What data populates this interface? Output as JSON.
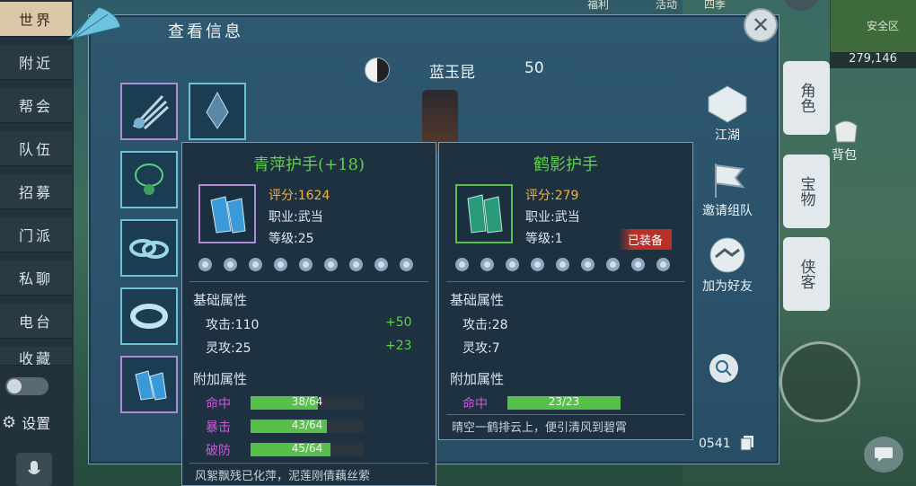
{
  "sidebar": {
    "tabs": [
      "世界",
      "附近",
      "帮会",
      "队伍",
      "招募",
      "门派",
      "私聊",
      "电台",
      "收藏"
    ],
    "active_index": 0,
    "settings_label": "设置"
  },
  "panel": {
    "title": "查看信息",
    "player": {
      "name": "蓝玉昆",
      "level": "50"
    },
    "actions": [
      "江湖",
      "邀请组队",
      "加为好友"
    ],
    "id_fragment": "0541"
  },
  "minimap": {
    "coords": "279,146",
    "zone": "安全区"
  },
  "right_tabs": [
    "角色",
    "宝物",
    "侠客"
  ],
  "map_labels": {
    "bag": "背包"
  },
  "top_hud": [
    "福利",
    "活动",
    "四季"
  ],
  "compare": {
    "left": {
      "name": "青萍护手(+18)",
      "score_label": "评分:1624",
      "class_label": "职业:武当",
      "level_label": "等级:25",
      "base_title": "基础属性",
      "base_stats": [
        {
          "label": "攻击:110",
          "bonus": "+50"
        },
        {
          "label": "灵攻:25",
          "bonus": "+23"
        }
      ],
      "extra_title": "附加属性",
      "extra_stats": [
        {
          "label": "命中",
          "text": "38/64",
          "value": 38,
          "max": 64,
          "color": "#c85ad8"
        },
        {
          "label": "暴击",
          "text": "43/64",
          "value": 43,
          "max": 64,
          "color": "#c85ad8"
        },
        {
          "label": "破防",
          "text": "45/64",
          "value": 45,
          "max": 64,
          "color": "#c85ad8"
        }
      ],
      "flavor": "风絮飘残已化萍，泥莲刚倩藕丝萦"
    },
    "right": {
      "name": "鹤影护手",
      "score_label": "评分:279",
      "class_label": "职业:武当",
      "level_label": "等级:1",
      "equipped_badge": "已装备",
      "base_title": "基础属性",
      "base_stats": [
        {
          "label": "攻击:28"
        },
        {
          "label": "灵攻:7"
        }
      ],
      "extra_title": "附加属性",
      "extra_stats": [
        {
          "label": "命中",
          "text": "23/23",
          "value": 23,
          "max": 23,
          "color": "#c85ad8"
        }
      ],
      "flavor": "晴空一鹤排云上，便引清风到碧霄"
    }
  },
  "colors": {
    "left_name": "#5fd04a",
    "right_name": "#5fd04a",
    "score": "#f0b43c",
    "bar_fill": "#56c04a"
  }
}
